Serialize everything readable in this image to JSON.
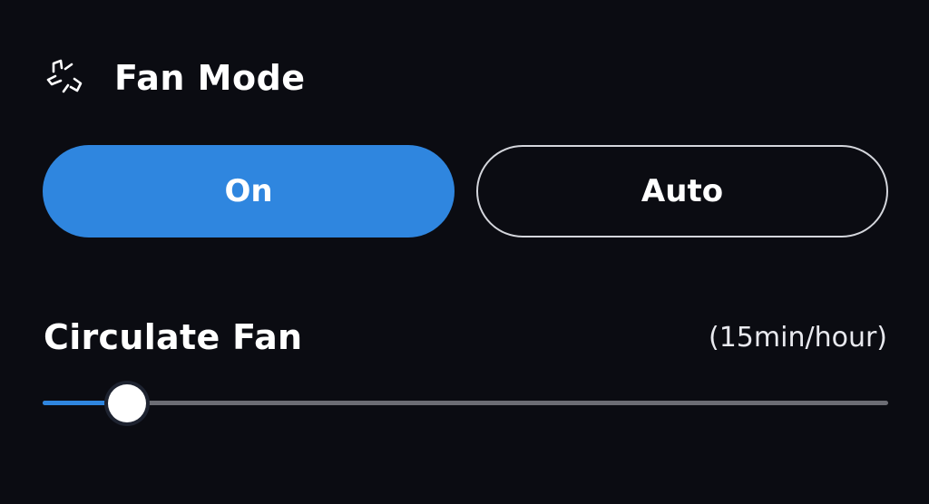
{
  "fan_mode": {
    "title": "Fan Mode",
    "icon": "fan-icon",
    "options": [
      {
        "label": "On",
        "selected": true
      },
      {
        "label": "Auto",
        "selected": false
      }
    ]
  },
  "circulate": {
    "label": "Circulate Fan",
    "value_text": "(15min/hour)",
    "slider_value": 0.1
  },
  "colors": {
    "background": "#0b0c12",
    "accent": "#2f86df",
    "outline": "#d4d6dc",
    "track": "#6c6d74"
  }
}
